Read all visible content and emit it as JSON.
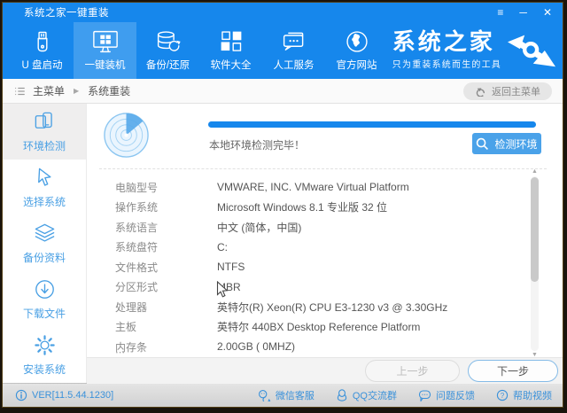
{
  "window": {
    "title": "系统之家一键重装",
    "controls": {
      "menu": "≡",
      "minimize": "─",
      "close": "✕"
    }
  },
  "nav": {
    "tabs": [
      {
        "label": "U 盘启动",
        "icon": "usb-icon",
        "active": false
      },
      {
        "label": "一键装机",
        "icon": "monitor-windows-icon",
        "active": true
      },
      {
        "label": "备份/还原",
        "icon": "backup-restore-icon",
        "active": false
      },
      {
        "label": "软件大全",
        "icon": "software-grid-icon",
        "active": false
      },
      {
        "label": "人工服务",
        "icon": "customer-service-icon",
        "active": false
      },
      {
        "label": "官方网站",
        "icon": "globe-icon",
        "active": false
      }
    ],
    "logo": {
      "title": "系统之家",
      "tagline": "只为重装系统而生的工具",
      "icon": "double-arrow-logo-icon"
    }
  },
  "breadcrumb": {
    "root": "主菜单",
    "separator": "▶",
    "current": "系统重装",
    "back_button": "返回主菜单"
  },
  "sidebar": {
    "items": [
      {
        "label": "环境检测",
        "icon": "devices-check-icon",
        "active": true
      },
      {
        "label": "选择系统",
        "icon": "cursor-select-icon",
        "active": false
      },
      {
        "label": "备份资料",
        "icon": "layers-icon",
        "active": false
      },
      {
        "label": "下载文件",
        "icon": "download-circle-icon",
        "active": false
      },
      {
        "label": "安装系统",
        "icon": "gear-icon",
        "active": false
      }
    ]
  },
  "main": {
    "status_text": "本地环境检测完毕！",
    "detect_button": "检测环境",
    "progress_percent": 100,
    "info_rows": [
      {
        "label": "电脑型号",
        "value": "VMWARE, INC. VMware Virtual Platform"
      },
      {
        "label": "操作系统",
        "value": "Microsoft Windows 8.1 专业版 32 位"
      },
      {
        "label": "系统语言",
        "value": "中文 (简体，中国)"
      },
      {
        "label": "系统盘符",
        "value": "C:"
      },
      {
        "label": "文件格式",
        "value": "NTFS"
      },
      {
        "label": "分区形式",
        "value": "MBR"
      },
      {
        "label": "处理器",
        "value": "英特尔(R) Xeon(R) CPU E3-1230 v3 @ 3.30GHz"
      },
      {
        "label": "主板",
        "value": "英特尔 440BX Desktop Reference Platform"
      },
      {
        "label": "内存条",
        "value": "2.00GB ( 0MHZ)"
      }
    ],
    "more_indicator": "⋯",
    "scrollbar": {
      "up": "▲",
      "down": "▼"
    },
    "prev_button": "上一步",
    "next_button": "下一步"
  },
  "statusbar": {
    "version": "VER[11.5.44.1230]",
    "links": [
      {
        "label": "微信客服",
        "icon": "wechat-icon"
      },
      {
        "label": "QQ交流群",
        "icon": "qq-icon"
      },
      {
        "label": "问题反馈",
        "icon": "feedback-icon"
      },
      {
        "label": "帮助视频",
        "icon": "help-icon"
      }
    ]
  },
  "colors": {
    "accent": "#1687ec",
    "active_tab": "#3f9def",
    "link_blue": "#3a91da",
    "sidebar_blue": "#4aa0e4"
  }
}
